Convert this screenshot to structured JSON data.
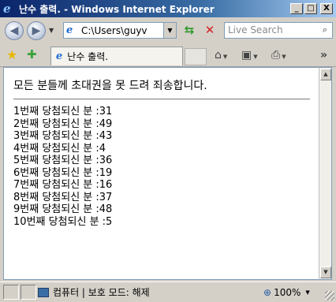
{
  "window": {
    "title": "난수 출력. - Windows Internet Explorer",
    "logo_icon": "ie-logo-icon",
    "buttons": {
      "minimize": "_",
      "maximize": "□",
      "close": "X"
    }
  },
  "nav": {
    "back_glyph": "◀",
    "forward_glyph": "▶",
    "address": "C:\\Users\\guyv",
    "search_placeholder": "Live Search",
    "search_glyph": "⌕"
  },
  "tabbar": {
    "tab_label": "난수 출력."
  },
  "page": {
    "heading": "모든 분들께 초대권을 못 드려 죄송합니다.",
    "lines": [
      "1번째 당첨되신 분 :31",
      "2번째 당첨되신 분 :49",
      "3번째 당첨되신 분 :43",
      "4번째 당첨되신 분 :4",
      "5번째 당첨되신 분 :36",
      "6번째 당첨되신 분 :19",
      "7번째 당첨되신 분 :16",
      "8번째 당첨되신 분 :37",
      "9번째 당첨되신 분 :48",
      "10번째 당첨되신 분 :5"
    ]
  },
  "statusbar": {
    "zone": "컴퓨터 | 보호 모드: 해제",
    "zoom": "100%"
  }
}
